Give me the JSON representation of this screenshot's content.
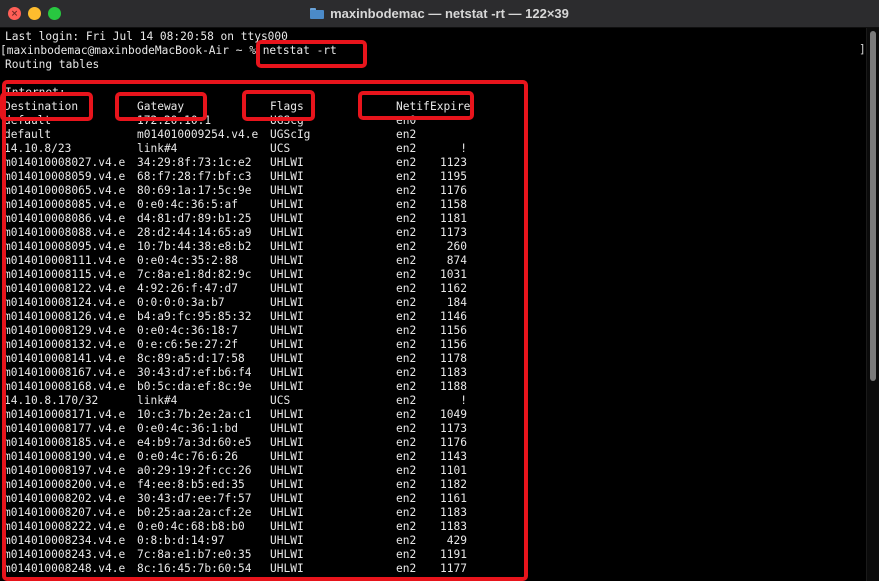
{
  "window": {
    "title": "maxinbodemac — netstat -rt — 122×39"
  },
  "icons": {
    "close": "close-icon",
    "minimize": "minimize-icon",
    "maximize": "maximize-icon",
    "folder": "folder-icon"
  },
  "colors": {
    "highlight": "#e8141c",
    "terminal_bg": "#000000",
    "terminal_fg": "#e8e8e8"
  },
  "terminal": {
    "login_line": "Last login: Fri Jul 14 08:20:58 on ttys000",
    "prompt": "[maxinbodemac@maxinbodeMacBook-Air ~ % ",
    "command": "netstat -rt",
    "routing_title": "Routing tables",
    "section": "Internet:",
    "headers": {
      "destination": "Destination",
      "gateway": "Gateway",
      "flags": "Flags",
      "netif": "Netif",
      "expire": "Expire"
    },
    "rows": [
      {
        "dest": "default",
        "gw": "172.20.10.1",
        "flags": "UGScg",
        "netif": "en0",
        "expire": ""
      },
      {
        "dest": "default",
        "gw": "m014010009254.v4.e",
        "flags": "UGScIg",
        "netif": "en2",
        "expire": ""
      },
      {
        "dest": "14.10.8/23",
        "gw": "link#4",
        "flags": "UCS",
        "netif": "en2",
        "expire": "!"
      },
      {
        "dest": "m014010008027.v4.e",
        "gw": "34:29:8f:73:1c:e2",
        "flags": "UHLWI",
        "netif": "en2",
        "expire": "1123"
      },
      {
        "dest": "m014010008059.v4.e",
        "gw": "68:f7:28:f7:bf:c3",
        "flags": "UHLWI",
        "netif": "en2",
        "expire": "1195"
      },
      {
        "dest": "m014010008065.v4.e",
        "gw": "80:69:1a:17:5c:9e",
        "flags": "UHLWI",
        "netif": "en2",
        "expire": "1176"
      },
      {
        "dest": "m014010008085.v4.e",
        "gw": "0:e0:4c:36:5:af",
        "flags": "UHLWI",
        "netif": "en2",
        "expire": "1158"
      },
      {
        "dest": "m014010008086.v4.e",
        "gw": "d4:81:d7:89:b1:25",
        "flags": "UHLWI",
        "netif": "en2",
        "expire": "1181"
      },
      {
        "dest": "m014010008088.v4.e",
        "gw": "28:d2:44:14:65:a9",
        "flags": "UHLWI",
        "netif": "en2",
        "expire": "1173"
      },
      {
        "dest": "m014010008095.v4.e",
        "gw": "10:7b:44:38:e8:b2",
        "flags": "UHLWI",
        "netif": "en2",
        "expire": "260"
      },
      {
        "dest": "m014010008111.v4.e",
        "gw": "0:e0:4c:35:2:88",
        "flags": "UHLWI",
        "netif": "en2",
        "expire": "874"
      },
      {
        "dest": "m014010008115.v4.e",
        "gw": "7c:8a:e1:8d:82:9c",
        "flags": "UHLWI",
        "netif": "en2",
        "expire": "1031"
      },
      {
        "dest": "m014010008122.v4.e",
        "gw": "4:92:26:f:47:d7",
        "flags": "UHLWI",
        "netif": "en2",
        "expire": "1162"
      },
      {
        "dest": "m014010008124.v4.e",
        "gw": "0:0:0:0:3a:b7",
        "flags": "UHLWI",
        "netif": "en2",
        "expire": "184"
      },
      {
        "dest": "m014010008126.v4.e",
        "gw": "b4:a9:fc:95:85:32",
        "flags": "UHLWI",
        "netif": "en2",
        "expire": "1146"
      },
      {
        "dest": "m014010008129.v4.e",
        "gw": "0:e0:4c:36:18:7",
        "flags": "UHLWI",
        "netif": "en2",
        "expire": "1156"
      },
      {
        "dest": "m014010008132.v4.e",
        "gw": "0:e:c6:5e:27:2f",
        "flags": "UHLWI",
        "netif": "en2",
        "expire": "1156"
      },
      {
        "dest": "m014010008141.v4.e",
        "gw": "8c:89:a5:d:17:58",
        "flags": "UHLWI",
        "netif": "en2",
        "expire": "1178"
      },
      {
        "dest": "m014010008167.v4.e",
        "gw": "30:43:d7:ef:b6:f4",
        "flags": "UHLWI",
        "netif": "en2",
        "expire": "1183"
      },
      {
        "dest": "m014010008168.v4.e",
        "gw": "b0:5c:da:ef:8c:9e",
        "flags": "UHLWI",
        "netif": "en2",
        "expire": "1188"
      },
      {
        "dest": "14.10.8.170/32",
        "gw": "link#4",
        "flags": "UCS",
        "netif": "en2",
        "expire": "!"
      },
      {
        "dest": "m014010008171.v4.e",
        "gw": "10:c3:7b:2e:2a:c1",
        "flags": "UHLWI",
        "netif": "en2",
        "expire": "1049"
      },
      {
        "dest": "m014010008177.v4.e",
        "gw": "0:e0:4c:36:1:bd",
        "flags": "UHLWI",
        "netif": "en2",
        "expire": "1173"
      },
      {
        "dest": "m014010008185.v4.e",
        "gw": "e4:b9:7a:3d:60:e5",
        "flags": "UHLWI",
        "netif": "en2",
        "expire": "1176"
      },
      {
        "dest": "m014010008190.v4.e",
        "gw": "0:e0:4c:76:6:26",
        "flags": "UHLWI",
        "netif": "en2",
        "expire": "1143"
      },
      {
        "dest": "m014010008197.v4.e",
        "gw": "a0:29:19:2f:cc:26",
        "flags": "UHLWI",
        "netif": "en2",
        "expire": "1101"
      },
      {
        "dest": "m014010008200.v4.e",
        "gw": "f4:ee:8:b5:ed:35",
        "flags": "UHLWI",
        "netif": "en2",
        "expire": "1182"
      },
      {
        "dest": "m014010008202.v4.e",
        "gw": "30:43:d7:ee:7f:57",
        "flags": "UHLWI",
        "netif": "en2",
        "expire": "1161"
      },
      {
        "dest": "m014010008207.v4.e",
        "gw": "b0:25:aa:2a:cf:2e",
        "flags": "UHLWI",
        "netif": "en2",
        "expire": "1183"
      },
      {
        "dest": "m014010008222.v4.e",
        "gw": "0:e0:4c:68:b8:b0",
        "flags": "UHLWI",
        "netif": "en2",
        "expire": "1183"
      },
      {
        "dest": "m014010008234.v4.e",
        "gw": "0:8:b:d:14:97",
        "flags": "UHLWI",
        "netif": "en2",
        "expire": "429"
      },
      {
        "dest": "m014010008243.v4.e",
        "gw": "7c:8a:e1:b7:e0:35",
        "flags": "UHLWI",
        "netif": "en2",
        "expire": "1191"
      },
      {
        "dest": "m014010008248.v4.e",
        "gw": "8c:16:45:7b:60:54",
        "flags": "UHLWI",
        "netif": "en2",
        "expire": "1177"
      }
    ]
  }
}
